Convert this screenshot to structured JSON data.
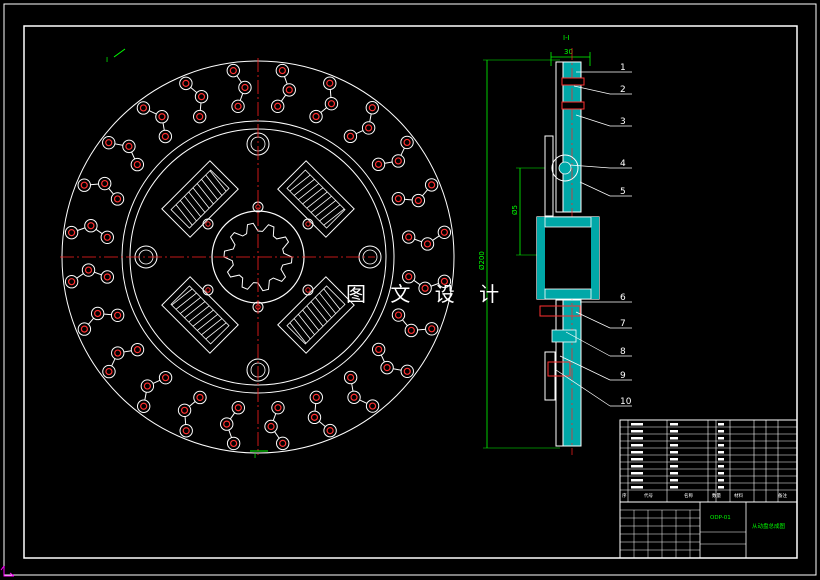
{
  "drawing": {
    "view_labels": [
      "I",
      "I",
      "I-I"
    ],
    "dim_labels": [
      "30",
      "Ø200",
      "Ø5"
    ],
    "watermark": "图 文 设 计",
    "part_numbers": [
      "1",
      "2",
      "3",
      "4",
      "5",
      "6",
      "7",
      "8",
      "9",
      "10"
    ]
  },
  "title_block": {
    "drawing_number": "ODP-01",
    "drawing_name": "从动盘总成图",
    "header_cols": [
      "序",
      "代号",
      "名称",
      "数量",
      "材料",
      "备注"
    ]
  },
  "colors": {
    "background": "#000000",
    "line": "#ffffff",
    "center_line": "#ff2020",
    "dimension": "#00ff00",
    "section": "#00b0b0",
    "accent_red": "#ff3030",
    "frame_corner": "#ff00ff"
  }
}
